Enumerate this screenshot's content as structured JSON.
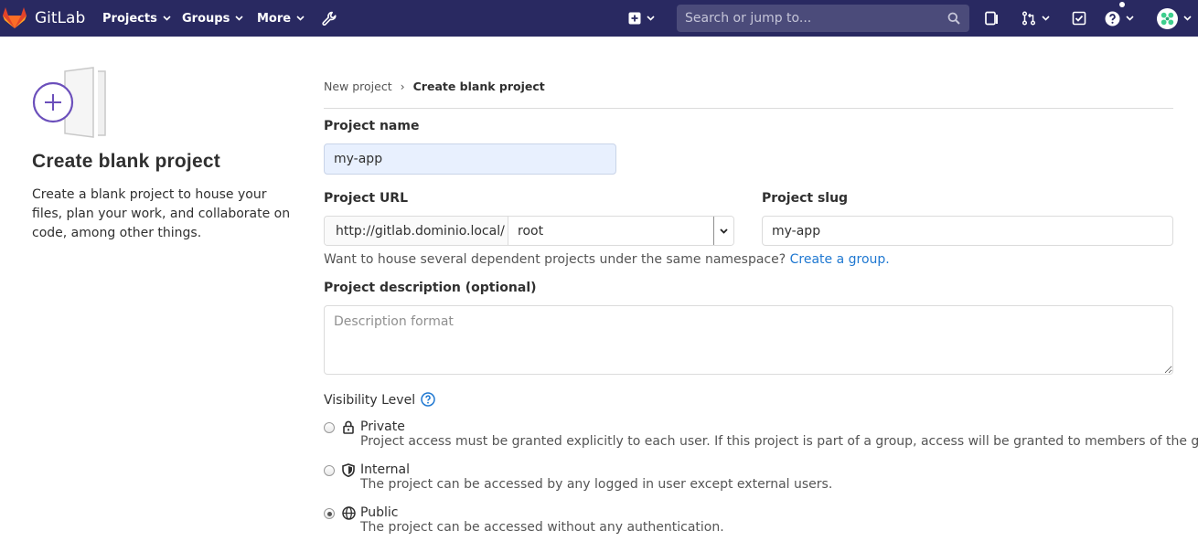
{
  "navbar": {
    "brand": "GitLab",
    "menus": [
      "Projects",
      "Groups",
      "More"
    ],
    "search_placeholder": "Search or jump to...",
    "icons": [
      "admin-wrench-icon",
      "plus-icon",
      "issues-icon",
      "merge-request-icon",
      "todos-icon",
      "help-icon",
      "avatar"
    ]
  },
  "sidebar": {
    "title": "Create blank project",
    "description": "Create a blank project to house your files, plan your work, and collaborate on code, among other things."
  },
  "breadcrumb": {
    "parent": "New project",
    "separator": "›",
    "current": "Create blank project"
  },
  "form": {
    "project_name_label": "Project name",
    "project_name_value": "my-app",
    "project_url_label": "Project URL",
    "url_prefix": "http://gitlab.dominio.local/",
    "namespace_value": "root",
    "project_slug_label": "Project slug",
    "project_slug_value": "my-app",
    "namespace_help_text": "Want to house several dependent projects under the same namespace?",
    "namespace_help_link": "Create a group.",
    "description_label": "Project description (optional)",
    "description_placeholder": "Description format",
    "visibility_label": "Visibility Level",
    "visibility_options": [
      {
        "title": "Private",
        "description": "Project access must be granted explicitly to each user. If this project is part of a group, access will be granted to members of the group.",
        "icon": "lock-icon",
        "checked": false
      },
      {
        "title": "Internal",
        "description": "The project can be accessed by any logged in user except external users.",
        "icon": "shield-icon",
        "checked": false
      },
      {
        "title": "Public",
        "description": "The project can be accessed without any authentication.",
        "icon": "globe-icon",
        "checked": true
      }
    ]
  },
  "colors": {
    "navbar_bg": "#292961",
    "link": "#1f78d1",
    "accent_purple": "#6b4fbb"
  }
}
